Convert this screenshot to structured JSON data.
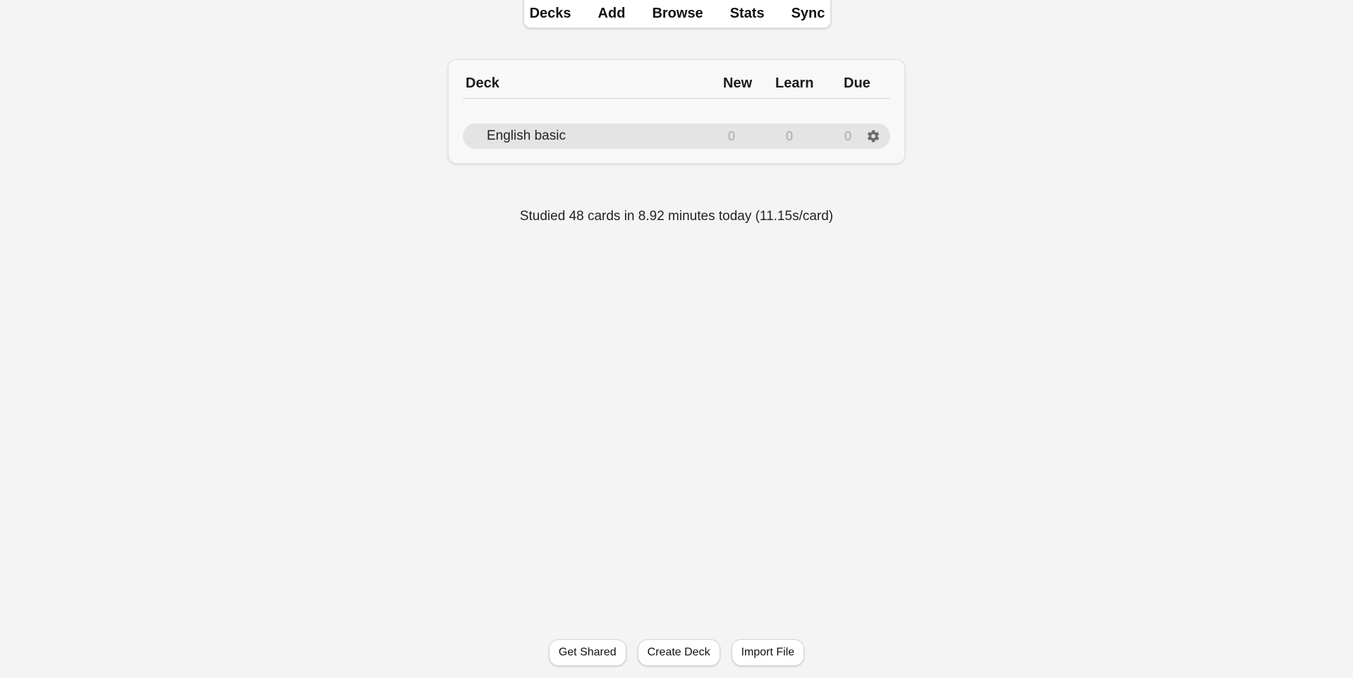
{
  "nav": {
    "items": [
      "Decks",
      "Add",
      "Browse",
      "Stats",
      "Sync"
    ]
  },
  "deck_table": {
    "headers": {
      "deck": "Deck",
      "new": "New",
      "learn": "Learn",
      "due": "Due"
    },
    "rows": [
      {
        "name": "English basic",
        "new": "0",
        "learn": "0",
        "due": "0",
        "options_icon": "gear-icon"
      }
    ]
  },
  "stats_text": "Studied 48 cards in 8.92 minutes today (11.15s/card)",
  "bottom_buttons": {
    "get_shared": "Get Shared",
    "create_deck": "Create Deck",
    "import_file": "Import File"
  },
  "colors": {
    "background": "#f4f4f4",
    "row_background": "#e4e4e4",
    "count_color": "#a8a8a8"
  }
}
